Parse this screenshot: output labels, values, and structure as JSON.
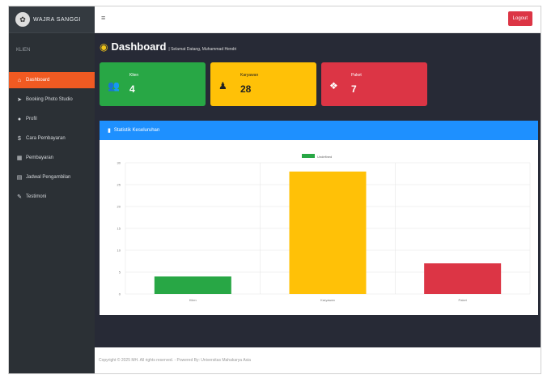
{
  "brand": {
    "name": "WAJRA SANGGI"
  },
  "sidebar": {
    "section_label": "KLIEN",
    "items": [
      {
        "label": "Dashboard",
        "icon": "home-icon",
        "active": true
      },
      {
        "label": "Booking Photo Studio",
        "icon": "send-icon",
        "active": false
      },
      {
        "label": "Profil",
        "icon": "user-icon",
        "active": false
      },
      {
        "label": "Cara Pembayaran",
        "icon": "dollar-icon",
        "active": false
      },
      {
        "label": "Pembayaran",
        "icon": "calendar-icon",
        "active": false
      },
      {
        "label": "Jadwal Pengambilan",
        "icon": "calendar-icon",
        "active": false
      },
      {
        "label": "Testimoni",
        "icon": "comments-icon",
        "active": false
      }
    ]
  },
  "topbar": {
    "menu_icon": "menu-icon",
    "logout_label": "Logout"
  },
  "page": {
    "title": "Dashboard",
    "subtitle": "| Selamat Datang, Muhammad Hendri"
  },
  "cards": [
    {
      "label": "Klien",
      "value": "4",
      "icon": "users-icon",
      "color": "#28a745"
    },
    {
      "label": "Karyawan",
      "value": "28",
      "icon": "user-tie-icon",
      "color": "#ffc107"
    },
    {
      "label": "Paket",
      "value": "7",
      "icon": "cubes-icon",
      "color": "#dc3545"
    }
  ],
  "panel": {
    "title": "Statistik Keseluruhan",
    "icon": "bar-chart-icon"
  },
  "chart_data": {
    "type": "bar",
    "categories": [
      "Klien",
      "Karyawan",
      "Paket"
    ],
    "values": [
      4,
      28,
      7
    ],
    "colors": [
      "#28a745",
      "#ffc107",
      "#dc3545"
    ],
    "legend": "Undefined",
    "legend_position": "top",
    "ylim": [
      0,
      30
    ],
    "yticks": [
      "0",
      "5",
      "10",
      "15",
      "20",
      "25",
      "30"
    ],
    "grid": true
  },
  "footer": {
    "text": "Copyright © 2025 MH. All rights reserved. - Powered By: Universitas Mahakarya Asia"
  }
}
